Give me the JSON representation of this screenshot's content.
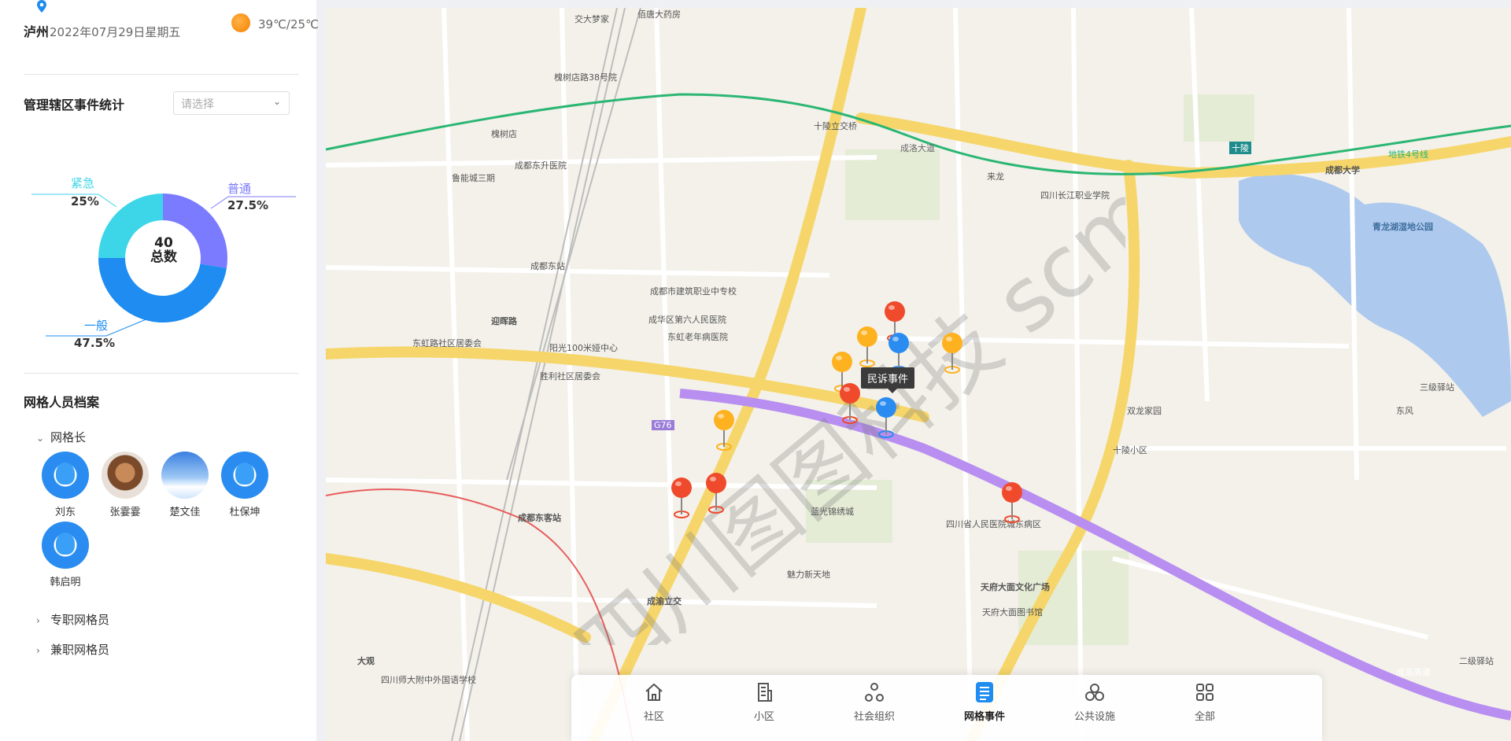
{
  "header": {
    "city": "泸州",
    "date": "2022年07月29日星期五",
    "temperature": "39℃/25℃",
    "weather_icon": "sun-icon"
  },
  "event_stats": {
    "title": "管理辖区事件统计",
    "select_placeholder": "请选择",
    "total_value": "40",
    "total_label": "总数",
    "segments": [
      {
        "label": "普通",
        "percent_text": "27.5%",
        "value": 27.5,
        "color": "#7b7bff"
      },
      {
        "label": "一般",
        "percent_text": "47.5%",
        "value": 47.5,
        "color": "#1e8cf0"
      },
      {
        "label": "紧急",
        "percent_text": "25%",
        "value": 25,
        "color": "#3dd6e8"
      }
    ]
  },
  "personnel": {
    "title": "网格人员档案",
    "groups": [
      {
        "label": "网格长",
        "expanded": true
      },
      {
        "label": "专职网格员",
        "expanded": false
      },
      {
        "label": "兼职网格员",
        "expanded": false
      }
    ],
    "members": [
      "刘东",
      "张霎霎",
      "楚文佳",
      "杜保坤",
      "韩启明"
    ]
  },
  "map": {
    "tooltip": "民诉事件",
    "watermark": "四川图图科技 scminfo.com",
    "labels": [
      {
        "text": "交大梦家"
      },
      {
        "text": "佰唐大药房"
      },
      {
        "text": "槐树店路38号院"
      },
      {
        "text": "槐树店"
      },
      {
        "text": "成都东升医院"
      },
      {
        "text": "鲁能城三期"
      },
      {
        "text": "成都东站"
      },
      {
        "text": "成都大学"
      },
      {
        "text": "十陵"
      },
      {
        "text": "十陵立交桥"
      },
      {
        "text": "来龙"
      },
      {
        "text": "四川长江职业学院"
      },
      {
        "text": "青龙湖湿地公园"
      },
      {
        "text": "成都市建筑职业中专校"
      },
      {
        "text": "成华区第六人民医院"
      },
      {
        "text": "迎晖路"
      },
      {
        "text": "胜利社区居委会"
      },
      {
        "text": "东虹路社区居委会"
      },
      {
        "text": "成都东客站"
      },
      {
        "text": "成渝立交"
      },
      {
        "text": "四川省人民医院城东病区"
      },
      {
        "text": "天府大面文化广场"
      },
      {
        "text": "天府大面图书馆"
      },
      {
        "text": "大观"
      },
      {
        "text": "四川师大附中外国语学校"
      },
      {
        "text": "成洛大道"
      },
      {
        "text": "地铁4号线"
      },
      {
        "text": "成渝高速"
      },
      {
        "text": "G76"
      },
      {
        "text": "二级驿站"
      },
      {
        "text": "三级驿站"
      },
      {
        "text": "东风"
      },
      {
        "text": "十陵小区"
      },
      {
        "text": "蓝光锦绣城"
      },
      {
        "text": "魅力新天地"
      },
      {
        "text": "东虹老年病医院"
      },
      {
        "text": "阳光100米娅中心"
      },
      {
        "text": "双龙家园"
      }
    ],
    "markers": [
      {
        "color": "red"
      },
      {
        "color": "orange"
      },
      {
        "color": "blue"
      },
      {
        "color": "orange"
      },
      {
        "color": "orange"
      },
      {
        "color": "red"
      },
      {
        "color": "blue"
      },
      {
        "color": "orange"
      },
      {
        "color": "red"
      },
      {
        "color": "red"
      },
      {
        "color": "red"
      }
    ]
  },
  "toolbar": {
    "items": [
      {
        "label": "社区",
        "icon": "house-icon",
        "active": false
      },
      {
        "label": "小区",
        "icon": "building-icon",
        "active": false
      },
      {
        "label": "社会组织",
        "icon": "network-icon",
        "active": false
      },
      {
        "label": "网格事件",
        "icon": "document-list-icon",
        "active": true
      },
      {
        "label": "公共设施",
        "icon": "facilities-icon",
        "active": false
      },
      {
        "label": "全部",
        "icon": "grid-icon",
        "active": false
      }
    ]
  }
}
